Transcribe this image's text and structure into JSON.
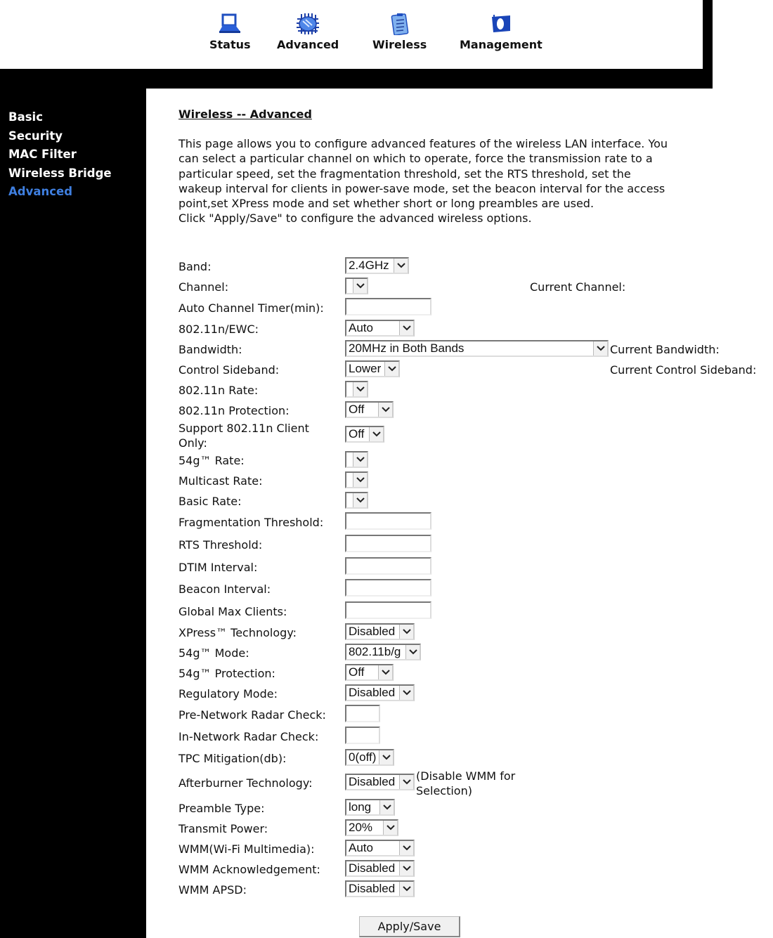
{
  "top_nav": [
    {
      "label": "Status",
      "icon": "laptop-icon"
    },
    {
      "label": "Advanced",
      "icon": "chip-icon"
    },
    {
      "label": "Wireless",
      "icon": "clipboard-icon"
    },
    {
      "label": "Management",
      "icon": "flag-icon"
    }
  ],
  "sidebar": {
    "items": [
      {
        "label": "Basic",
        "active": false
      },
      {
        "label": "Security",
        "active": false
      },
      {
        "label": "MAC Filter",
        "active": false
      },
      {
        "label": "Wireless Bridge",
        "active": false
      },
      {
        "label": "Advanced",
        "active": true
      }
    ],
    "active_color": "#3f7fe0"
  },
  "page": {
    "title": "Wireless -- Advanced",
    "intro_lines": [
      "This page allows you to configure advanced features of the wireless LAN interface. You",
      "can select a particular channel on which to operate, force the transmission rate to a",
      "particular speed, set the fragmentation threshold, set the RTS threshold, set the",
      "wakeup interval for clients in power-save mode, set the beacon interval for the access",
      "point,set XPress mode and set whether short or long preambles are used.",
      "Click \"Apply/Save\" to configure the advanced wireless options."
    ]
  },
  "form": {
    "band": {
      "label": "Band:",
      "value": "2.4GHz"
    },
    "channel": {
      "label": "Channel:",
      "value": "",
      "current_label": "Current Channel:"
    },
    "auto_channel_timer": {
      "label": "Auto Channel Timer(min):",
      "value": ""
    },
    "ewc": {
      "label": "802.11n/EWC:",
      "value": "Auto"
    },
    "bandwidth": {
      "label": "Bandwidth:",
      "value": "20MHz in Both Bands",
      "current_label": "Current Bandwidth:"
    },
    "control_sideband": {
      "label": "Control Sideband:",
      "value": "Lower",
      "current_label": "Current Control Sideband:"
    },
    "n_rate": {
      "label": "802.11n Rate:",
      "value": ""
    },
    "n_protection": {
      "label": "802.11n Protection:",
      "value": "Off"
    },
    "n_client_only": {
      "label_line1": "Support 802.11n Client",
      "label_line2": "Only:",
      "value": "Off"
    },
    "g_rate": {
      "label": "54g™ Rate:",
      "value": ""
    },
    "multicast_rate": {
      "label": "Multicast Rate:",
      "value": ""
    },
    "basic_rate": {
      "label": "Basic Rate:",
      "value": ""
    },
    "frag_threshold": {
      "label": "Fragmentation Threshold:",
      "value": ""
    },
    "rts_threshold": {
      "label": "RTS Threshold:",
      "value": ""
    },
    "dtim_interval": {
      "label": "DTIM Interval:",
      "value": ""
    },
    "beacon_interval": {
      "label": "Beacon Interval:",
      "value": ""
    },
    "global_max_clients": {
      "label": "Global Max Clients:",
      "value": ""
    },
    "xpress": {
      "label": "XPress™ Technology:",
      "value": "Disabled"
    },
    "g_mode": {
      "label": "54g™ Mode:",
      "value": "802.11b/g"
    },
    "g_protection": {
      "label": "54g™ Protection:",
      "value": "Off"
    },
    "regulatory_mode": {
      "label": "Regulatory Mode:",
      "value": "Disabled"
    },
    "pre_radar": {
      "label": "Pre-Network Radar Check:",
      "value": ""
    },
    "in_radar": {
      "label": "In-Network Radar Check:",
      "value": ""
    },
    "tpc": {
      "label": "TPC Mitigation(db):",
      "value": "0(off)"
    },
    "afterburner": {
      "label": "Afterburner Technology:",
      "value": "Disabled",
      "note_line1": "(Disable WMM for",
      "note_line2": "Selection)"
    },
    "preamble": {
      "label": "Preamble Type:",
      "value": "long"
    },
    "tx_power": {
      "label": "Transmit Power:",
      "value": "20%"
    },
    "wmm": {
      "label": "WMM(Wi-Fi Multimedia):",
      "value": "Auto"
    },
    "wmm_ack": {
      "label": "WMM Acknowledgement:",
      "value": "Disabled"
    },
    "wmm_apsd": {
      "label": "WMM APSD:",
      "value": "Disabled"
    }
  },
  "actions": {
    "apply_save": "Apply/Save"
  }
}
